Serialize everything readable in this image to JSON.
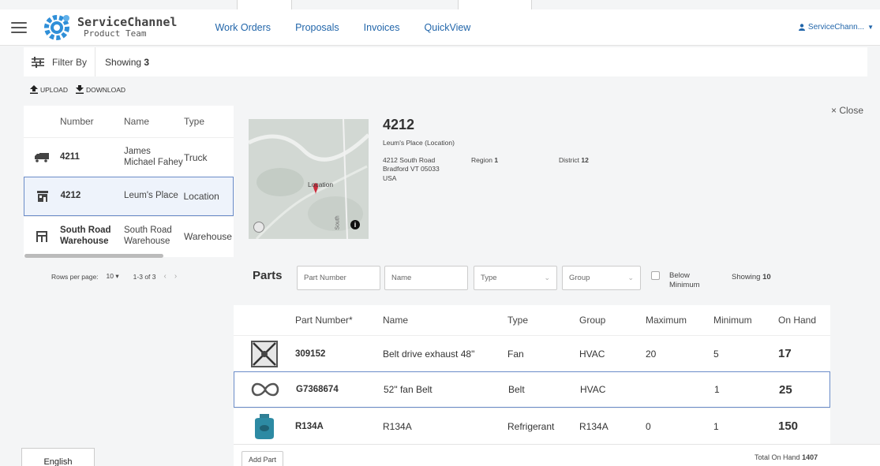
{
  "header": {
    "logo_title": "ServiceChannel",
    "logo_subtitle": "Product Team",
    "nav": [
      "Work Orders",
      "Proposals",
      "Invoices",
      "QuickView"
    ],
    "user": "ServiceChann..."
  },
  "filter": {
    "label": "Filter By",
    "showing_label": "Showing",
    "showing_count": "3"
  },
  "actions": {
    "upload": "UPLOAD",
    "download": "DOWNLOAD"
  },
  "list": {
    "headers": {
      "number": "Number",
      "name": "Name",
      "type": "Type"
    },
    "rows": [
      {
        "icon": "truck-icon",
        "number": "4211",
        "name": "James Michael Fahey",
        "type": "Truck"
      },
      {
        "icon": "store-icon",
        "number": "4212",
        "name": "Leum's Place",
        "type": "Location"
      },
      {
        "icon": "warehouse-icon",
        "number": "South Road Warehouse",
        "name": "South Road Warehouse",
        "type": "Warehouse"
      }
    ]
  },
  "pager": {
    "rows_per_page_label": "Rows per page:",
    "rows_per_page": "10",
    "range": "1-3 of 3"
  },
  "language": "English",
  "detail": {
    "close": "× Close",
    "title": "4212",
    "subtitle": "Leum's Place (Location)",
    "address": [
      "4212 South Road",
      "Bradford VT 05033",
      "USA"
    ],
    "region_label": "Region",
    "region": "1",
    "district_label": "District",
    "district": "12",
    "map_label": "Location",
    "map_road": "South"
  },
  "parts": {
    "title": "Parts",
    "filters": {
      "part_number_placeholder": "Part Number",
      "name_placeholder": "Name",
      "type_placeholder": "Type",
      "group_placeholder": "Group",
      "below_min": "Below Minimum"
    },
    "showing_label": "Showing",
    "showing_count": "10",
    "headers": {
      "part_number": "Part Number*",
      "name": "Name",
      "type": "Type",
      "group": "Group",
      "maximum": "Maximum",
      "minimum": "Minimum",
      "on_hand": "On Hand"
    },
    "rows": [
      {
        "image": "exhaust-fan-icon",
        "part_number": "309152",
        "name": "Belt drive exhaust 48\"",
        "type": "Fan",
        "group": "HVAC",
        "maximum": "20",
        "minimum": "5",
        "on_hand": "17"
      },
      {
        "image": "belt-icon",
        "part_number": "G7368674",
        "name": "52\" fan Belt",
        "type": "Belt",
        "group": "HVAC",
        "maximum": "",
        "minimum": "1",
        "on_hand": "25"
      },
      {
        "image": "refrigerant-tank-icon",
        "part_number": "R134A",
        "name": "R134A",
        "type": "Refrigerant",
        "group": "R134A",
        "maximum": "0",
        "minimum": "1",
        "on_hand": "150"
      }
    ],
    "add_part": "Add Part",
    "total_label": "Total On Hand",
    "total": "1407"
  },
  "colors": {
    "link": "#2266aa",
    "selection_border": "#6a8cc8",
    "logo_blue": "#2f8fd8"
  }
}
